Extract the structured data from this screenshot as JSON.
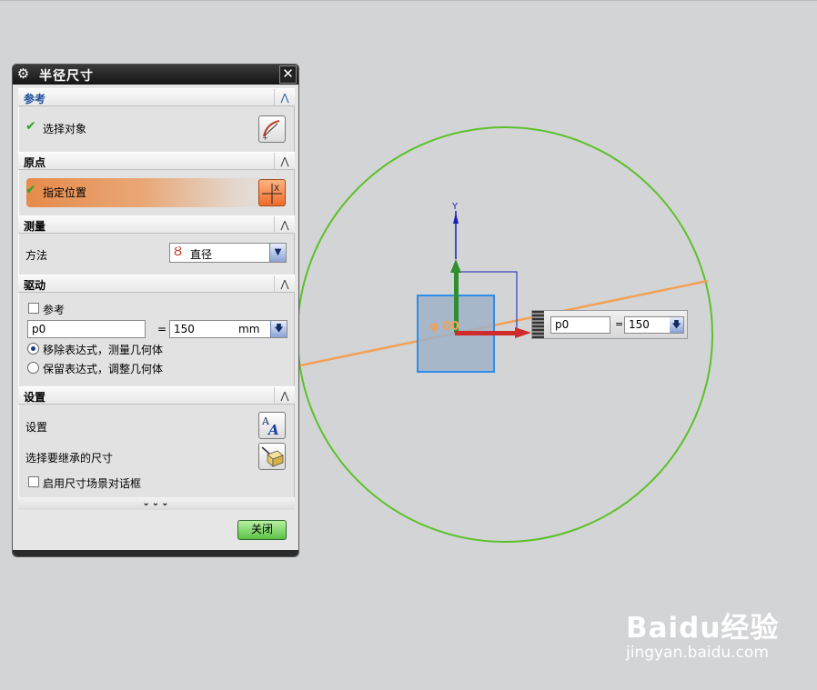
{
  "dialog": {
    "title": "半径尺寸",
    "sections": {
      "reference": {
        "title": "参考",
        "select_object_label": "选择对象"
      },
      "origin": {
        "title": "原点",
        "specify_position_label": "指定位置"
      },
      "measure": {
        "title": "测量",
        "method_label": "方法",
        "method_value": "直径"
      },
      "drive": {
        "title": "驱动",
        "reference_checkbox_label": "参考",
        "expression_name": "p0",
        "equals": "=",
        "expression_value": "150",
        "unit": "mm",
        "radio_options": [
          "移除表达式，测量几何体",
          "保留表达式，调整几何体"
        ],
        "selected_radio": 0
      },
      "settings": {
        "title": "设置",
        "settings_label": "设置",
        "inherit_label": "选择要继承的尺寸",
        "enable_dialog_label": "启用尺寸场景对话框"
      }
    },
    "more_label": "⌄⌄⌄",
    "close_label": "关闭"
  },
  "viewport": {
    "axis_y_label": "Y",
    "dimension_text": "φ 00",
    "float_input": {
      "name": "p0",
      "equals": "=",
      "value": "150"
    }
  },
  "colors": {
    "circle": "#5cc128",
    "leader": "#f2a156",
    "sketch_fill": "#9fb0c6",
    "sketch_border": "#2e8cea",
    "axis_green": "#2f8f2f",
    "axis_red": "#d12a2a",
    "axis_blue": "#1420b8"
  },
  "watermark": {
    "logo": "Baidu经验",
    "url": "jingyan.baidu.com"
  }
}
